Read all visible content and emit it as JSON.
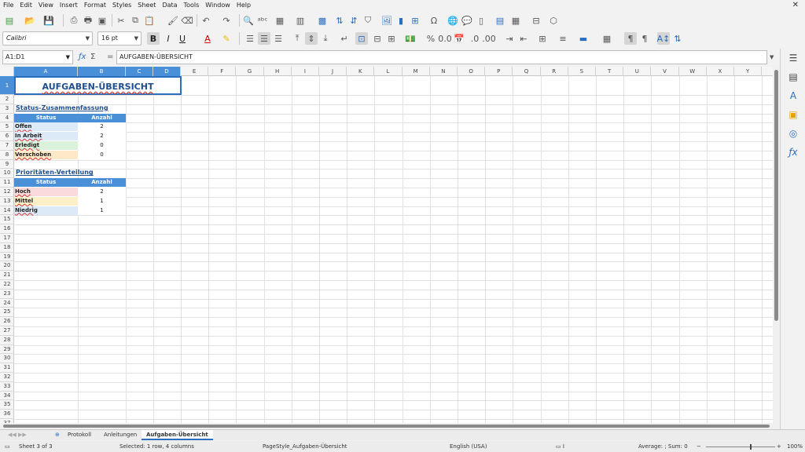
{
  "menu": [
    "File",
    "Edit",
    "View",
    "Insert",
    "Format",
    "Styles",
    "Sheet",
    "Data",
    "Tools",
    "Window",
    "Help"
  ],
  "font": {
    "name": "Calibri",
    "size": "16 pt"
  },
  "formula": {
    "cell_ref": "A1:D1",
    "content": "AUFGABEN-ÜBERSICHT"
  },
  "columns": [
    "A",
    "B",
    "C",
    "D",
    "E",
    "F",
    "G",
    "H",
    "I",
    "J",
    "K",
    "L",
    "M",
    "N",
    "O",
    "P",
    "Q",
    "R",
    "S",
    "T",
    "U",
    "V",
    "W",
    "X",
    "Y"
  ],
  "rows": [
    "1",
    "2",
    "3",
    "4",
    "5",
    "6",
    "7",
    "8",
    "9",
    "10",
    "11",
    "12",
    "13",
    "14",
    "15",
    "16",
    "17",
    "18",
    "19",
    "20",
    "21",
    "22",
    "23",
    "24",
    "25",
    "26",
    "27",
    "28",
    "29",
    "30",
    "31",
    "32",
    "33",
    "34",
    "35",
    "36",
    "37"
  ],
  "sheet": {
    "title": "AUFGABEN-ÜBERSICHT",
    "status_section": "Status-Zusammenfassung",
    "status_header": [
      "Status",
      "Anzahl"
    ],
    "status_rows": [
      {
        "label": "Offen",
        "value": "2",
        "color": "#dce9f7"
      },
      {
        "label": "In Arbeit",
        "value": "2",
        "color": "#dce9f7"
      },
      {
        "label": "Erledigt",
        "value": "0",
        "color": "#d9f2d9"
      },
      {
        "label": "Verschoben",
        "value": "0",
        "color": "#fde9c8"
      }
    ],
    "priority_section": "Prioritäten-Verteilung",
    "priority_header": [
      "Status",
      "Anzahl"
    ],
    "priority_rows": [
      {
        "label": "Hoch",
        "value": "2",
        "color": "#fadada"
      },
      {
        "label": "Mittel",
        "value": "1",
        "color": "#fdf0c8"
      },
      {
        "label": "Niedrig",
        "value": "1",
        "color": "#dce9f7"
      }
    ]
  },
  "tabs": [
    "Protokoll",
    "Anleitungen",
    "Aufgaben-Übersicht"
  ],
  "status": {
    "sheet": "Sheet 3 of 3",
    "selection": "Selected: 1 row, 4 columns",
    "pagestyle": "PageStyle_Aufgaben-Übersicht",
    "language": "English (USA)",
    "sum": "Average: ; Sum: 0",
    "zoom": "100%"
  }
}
